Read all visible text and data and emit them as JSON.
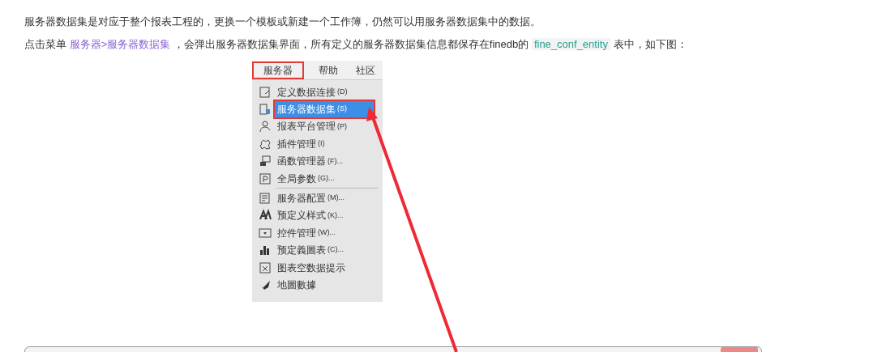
{
  "paragraphs": [
    {
      "text": "服务器数据集是对应于整个报表工程的，更换一个模板或新建一个工作簿，仍然可以用服务器数据集中的数据。"
    },
    {
      "parts": [
        {
          "kind": "plain",
          "text": "点击菜单 "
        },
        {
          "kind": "link",
          "text": "服务器>服务器数据集"
        },
        {
          "kind": "plain",
          "text": " ，会弹出服务器数据集界面，所有定义的服务器数据集信息都保存在finedb的 "
        },
        {
          "kind": "code",
          "text": "fine_conf_entity"
        },
        {
          "kind": "plain",
          "text": " 表中，如下图："
        }
      ]
    }
  ],
  "menu_bar": [
    {
      "label": "服务器",
      "selected": true
    },
    {
      "label": "帮助",
      "selected": false
    },
    {
      "label": "社区",
      "selected": false
    }
  ],
  "menu_items": [
    {
      "kind": "item",
      "label": "定义数据连接",
      "shortcut": "(D)",
      "selected": false
    },
    {
      "kind": "item",
      "label": "服务器数据集",
      "shortcut": "(S)",
      "selected": true
    },
    {
      "kind": "item",
      "label": "报表平台管理",
      "shortcut": "(P)",
      "selected": false
    },
    {
      "kind": "item",
      "label": "插件管理",
      "shortcut": "(I)",
      "selected": false
    },
    {
      "kind": "item",
      "label": "函数管理器",
      "shortcut": "(F)...",
      "selected": false
    },
    {
      "kind": "item",
      "label": "全局参数",
      "shortcut": "(G)...",
      "selected": false
    },
    {
      "kind": "separator"
    },
    {
      "kind": "item",
      "label": "服务器配置",
      "shortcut": "(M)...",
      "selected": false
    },
    {
      "kind": "item",
      "label": "预定义样式",
      "shortcut": "(K)...",
      "selected": false
    },
    {
      "kind": "item",
      "label": "控件管理",
      "shortcut": "(W)...",
      "selected": false
    },
    {
      "kind": "item",
      "label": "预定義圖表",
      "shortcut": "(C)...",
      "selected": false
    },
    {
      "kind": "item",
      "label": "图表空数据提示",
      "selected": false
    },
    {
      "kind": "item",
      "label": "地圖數據",
      "selected": false
    }
  ]
}
